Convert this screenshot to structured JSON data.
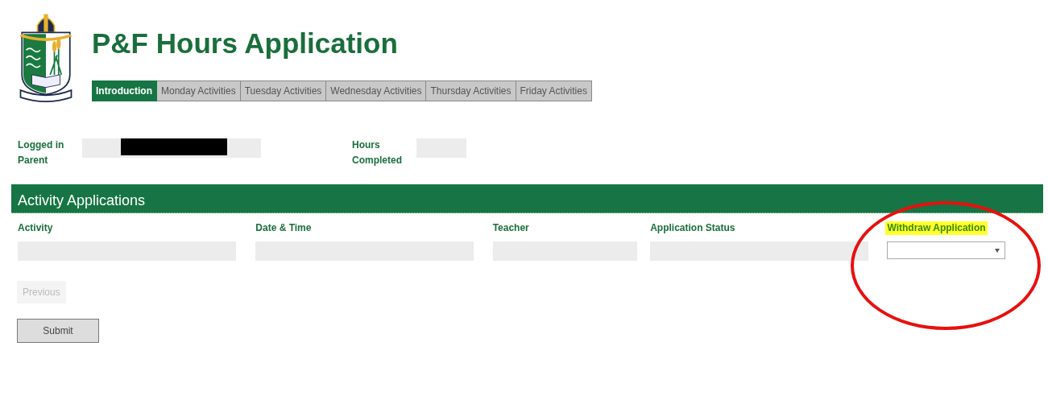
{
  "header": {
    "title": "P&F Hours Application"
  },
  "tabs": [
    {
      "label": "Introduction",
      "selected": true
    },
    {
      "label": "Monday Activities",
      "selected": false
    },
    {
      "label": "Tuesday Activities",
      "selected": false
    },
    {
      "label": "Wednesday Activities",
      "selected": false
    },
    {
      "label": "Thursday Activities",
      "selected": false
    },
    {
      "label": "Friday Activities",
      "selected": false
    }
  ],
  "info": [
    {
      "label": "Logged in Parent",
      "kind": "wide",
      "redacted": true
    },
    {
      "label": "Hours Completed",
      "kind": "narrow",
      "redacted": false
    }
  ],
  "section": {
    "title": "Activity Applications"
  },
  "columns": [
    {
      "label": "Activity",
      "kind": "text",
      "highlighted": false
    },
    {
      "label": "Date & Time",
      "kind": "text",
      "highlighted": false
    },
    {
      "label": "Teacher",
      "kind": "text",
      "highlighted": false
    },
    {
      "label": "Application Status",
      "kind": "text",
      "highlighted": false
    },
    {
      "label": "Withdraw Application",
      "kind": "select",
      "highlighted": true
    }
  ],
  "previous_button": {
    "label": "Previous",
    "disabled": true
  },
  "submit_button": {
    "label": "Submit"
  },
  "annotation": {
    "kind": "ellipse"
  }
}
